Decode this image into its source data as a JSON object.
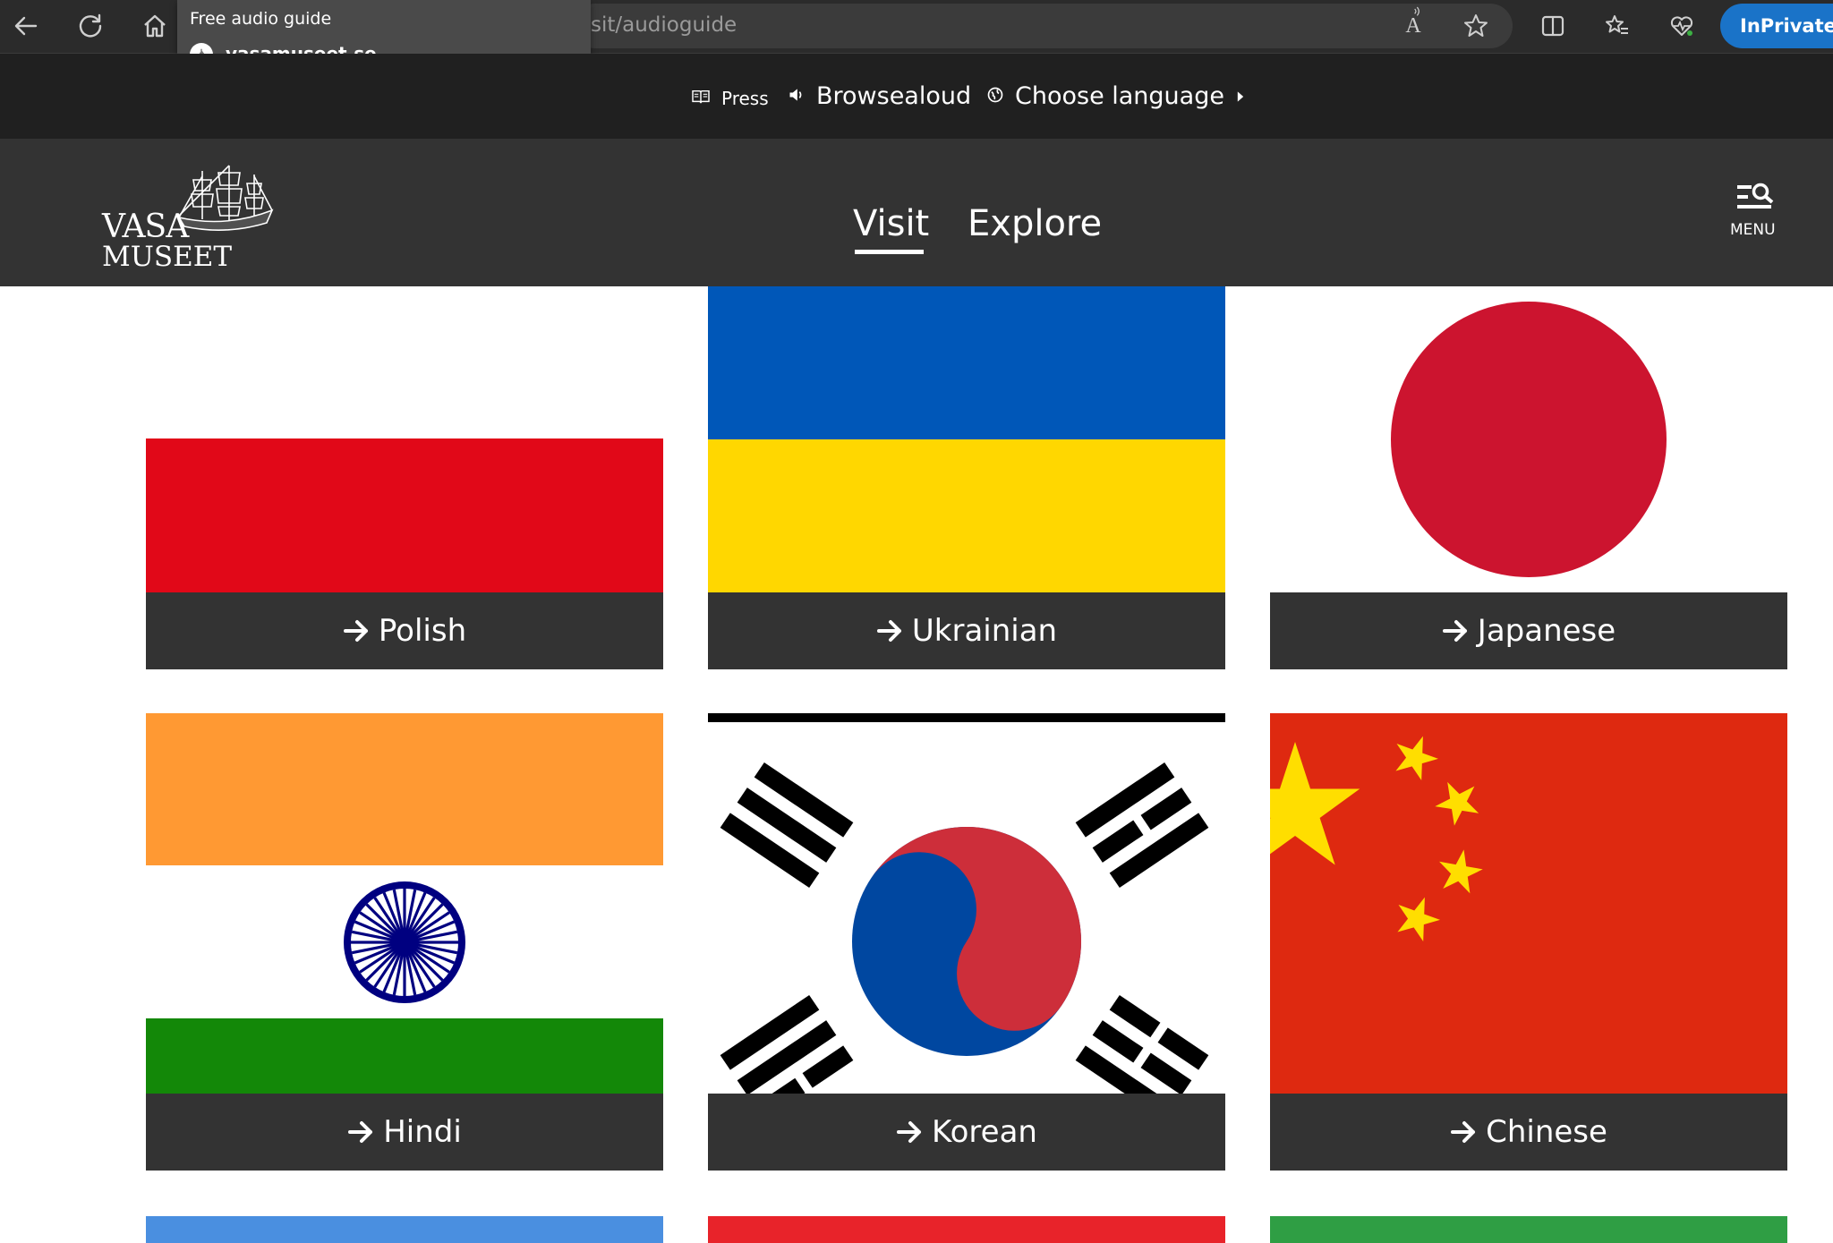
{
  "browser": {
    "address_text": "sit/audioguide",
    "read_aloud_label": "A",
    "inprivate_label": "InPrivate",
    "tooltip": {
      "title": "Free audio guide",
      "domain": "vasamuseet.se"
    }
  },
  "utility_bar": {
    "press_label": "Press",
    "browsealoud_label": "Browsealoud",
    "language_label": "Choose language"
  },
  "header": {
    "logo_line1": "VASA",
    "logo_line2": "MUSEET",
    "nav": {
      "visit": "Visit",
      "explore": "Explore"
    },
    "menu_label": "MENU"
  },
  "languages": [
    {
      "label": "Polish"
    },
    {
      "label": "Ukrainian"
    },
    {
      "label": "Japanese"
    },
    {
      "label": "Hindi"
    },
    {
      "label": "Korean"
    },
    {
      "label": "Chinese"
    }
  ],
  "colors": {
    "header_bg": "#333333",
    "utility_bg": "#202020",
    "inprivate_bg": "#1a73c8",
    "polish_red": "#e10818",
    "ukraine_blue": "#0057b8",
    "ukraine_yellow": "#ffd700",
    "japan_red": "#cc142f",
    "india_saffron": "#ff9933",
    "india_green": "#138808",
    "india_chakra": "#000080",
    "china_red": "#de2910",
    "china_yellow": "#ffde00",
    "korea_red": "#cd2e3a",
    "korea_blue": "#0047a0"
  }
}
